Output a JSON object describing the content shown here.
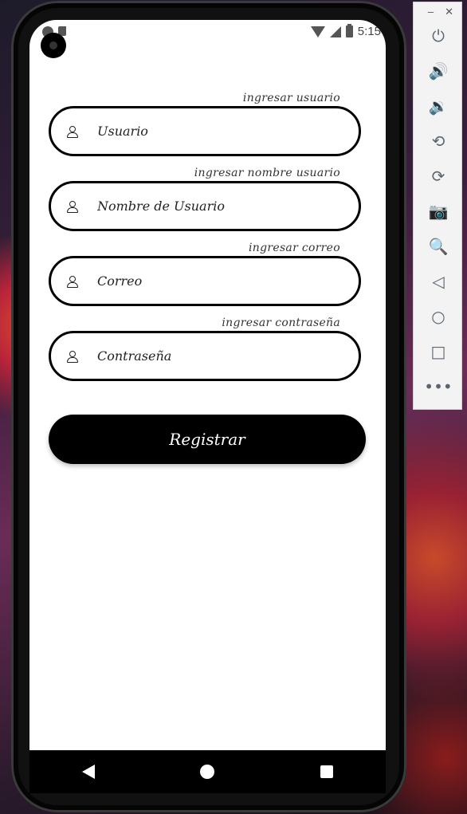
{
  "status_bar": {
    "time": "5:15"
  },
  "form": {
    "fields": [
      {
        "hint": "ingresar usuario",
        "placeholder": "Usuario"
      },
      {
        "hint": "ingresar nombre usuario",
        "placeholder": "Nombre de Usuario"
      },
      {
        "hint": "ingresar correo",
        "placeholder": "Correo"
      },
      {
        "hint": "ingresar contraseña",
        "placeholder": "Contraseña"
      }
    ],
    "submit_label": "Registrar"
  },
  "emulator_toolbar": {
    "minimize": "–",
    "close": "✕",
    "tools": [
      {
        "icon": "power-icon",
        "glyph": "⏻"
      },
      {
        "icon": "volume-up-icon",
        "glyph": "🔊"
      },
      {
        "icon": "volume-down-icon",
        "glyph": "🔉"
      },
      {
        "icon": "rotate-left-icon",
        "glyph": "⟲"
      },
      {
        "icon": "rotate-right-icon",
        "glyph": "⟳"
      },
      {
        "icon": "camera-icon",
        "glyph": "📷"
      },
      {
        "icon": "zoom-icon",
        "glyph": "🔍"
      },
      {
        "icon": "back-icon",
        "glyph": "◁"
      },
      {
        "icon": "home-icon",
        "glyph": "○"
      },
      {
        "icon": "overview-icon",
        "glyph": "□"
      },
      {
        "icon": "more-icon",
        "glyph": "•••"
      }
    ]
  }
}
